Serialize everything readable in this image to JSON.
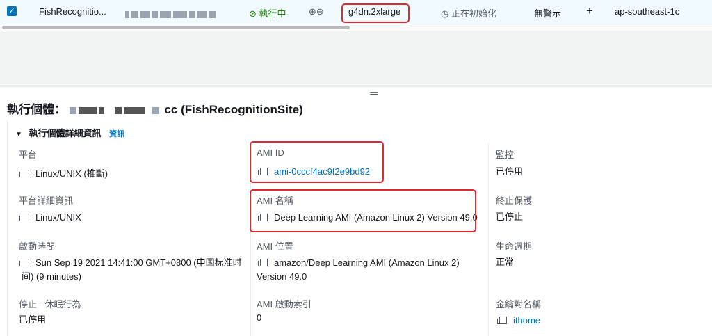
{
  "row": {
    "name": "FishRecognitio...",
    "state": "執行中",
    "instance_type": "g4dn.2xlarge",
    "status_check": "正在初始化",
    "alarm": "無警示",
    "az": "ap-southeast-1c"
  },
  "title": {
    "prefix": "執行個體：",
    "suffix": "cc (FishRecognitionSite)"
  },
  "section": {
    "label": "執行個體詳細資訊",
    "info": "資訊"
  },
  "fields": {
    "platform_label": "平台",
    "platform_value": "Linux/UNIX (推斷)",
    "platform_detail_label": "平台詳細資訊",
    "platform_detail_value": "Linux/UNIX",
    "launch_label": "啟動時間",
    "launch_value": "Sun Sep 19 2021 14:41:00 GMT+0800 (中国标准时间) (9 minutes)",
    "stop_label": "停止 - 休眠行為",
    "stop_value": "已停用",
    "ami_id_label": "AMI ID",
    "ami_id_value": "ami-0cccf4ac9f2e9bd92",
    "ami_name_label": "AMI 名稱",
    "ami_name_value": "Deep Learning AMI (Amazon Linux 2) Version 49.0",
    "ami_location_label": "AMI 位置",
    "ami_location_value": "amazon/Deep Learning AMI (Amazon Linux 2) Version 49.0",
    "ami_launch_index_label": "AMI 啟動索引",
    "ami_launch_index_value": "0",
    "monitoring_label": "監控",
    "monitoring_value": "已停用",
    "termination_label": "終止保護",
    "termination_value": "已停止",
    "lifecycle_label": "生命週期",
    "lifecycle_value": "正常",
    "keypair_label": "金鑰對名稱",
    "keypair_value": "ithome"
  },
  "colors": {
    "accent": "#0073bb",
    "highlight": "#e0282f",
    "running": "#1d8102"
  }
}
